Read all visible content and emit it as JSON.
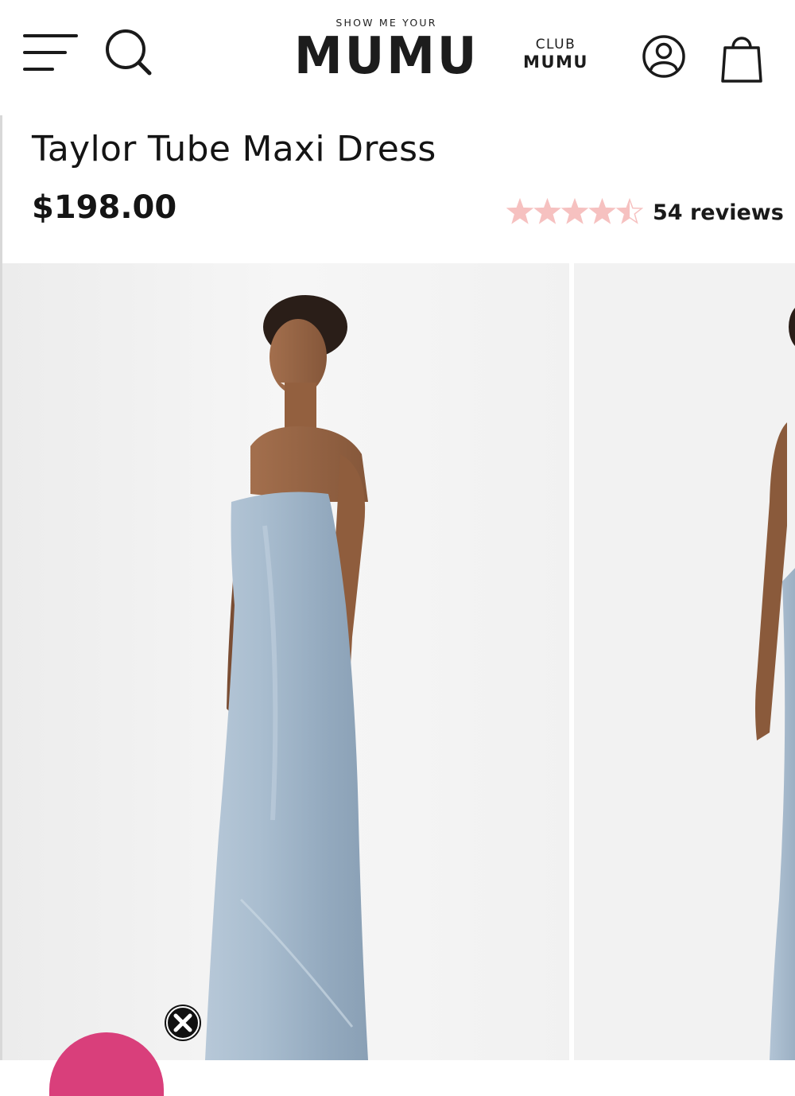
{
  "header": {
    "logo_top": "SHOW ME YOUR",
    "logo_main": "MUMU",
    "club_top": "CLUB",
    "club_main": "MUMU",
    "icons": {
      "menu": "hamburger-menu-icon",
      "search": "search-icon",
      "account": "account-icon",
      "bag": "shopping-bag-icon"
    }
  },
  "product": {
    "title": "Taylor Tube Maxi Dress",
    "price": "$198.00",
    "rating": {
      "stars": 4.5,
      "max": 5,
      "star_color": "#f6c1c0",
      "reviews_label": "54 reviews"
    }
  },
  "gallery": {
    "images": [
      "model-in-light-blue-satin-strapless-maxi-dress-side-view",
      "model-in-light-blue-satin-maxi-dress-partial-view"
    ],
    "dress_color": "#a4b9cc"
  },
  "overlay": {
    "close_icon": "close-x-icon",
    "promo_color": "#d93f7b"
  }
}
